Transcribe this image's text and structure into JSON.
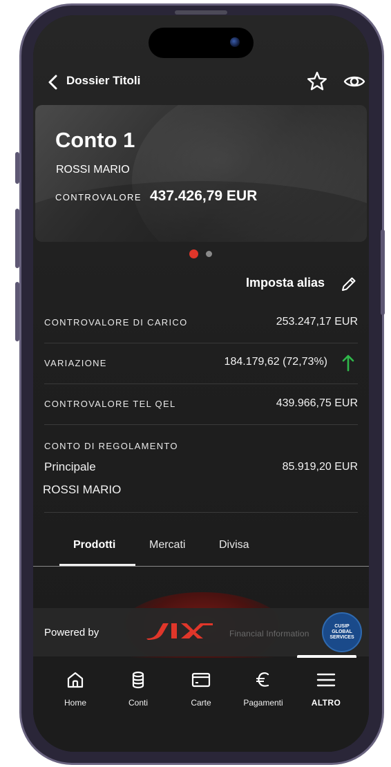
{
  "header": {
    "title": "Dossier Titoli"
  },
  "card": {
    "account_name": "Conto 1",
    "owner": "ROSSI MARIO",
    "controvalore_label": "CONTROVALORE",
    "controvalore_value": "437.426,79 EUR"
  },
  "pager": {
    "pages": 2,
    "active": 1
  },
  "alias": {
    "label": "Imposta alias"
  },
  "details": {
    "carico_label": "CONTROVALORE DI CARICO",
    "carico_value": "253.247,17 EUR",
    "variazione_label": "VARIAZIONE",
    "variazione_value": "184.179,62 (72,73%)",
    "variazione_trend": "up",
    "telqel_label": "CONTROVALORE TEL QEL",
    "telqel_value": "439.966,75 EUR",
    "regolamento_label": "CONTO DI REGOLAMENTO",
    "regolamento_name": "Principale",
    "regolamento_value": "85.919,20 EUR",
    "regolamento_owner": "ROSSI MARIO"
  },
  "tabs": [
    {
      "label": "Prodotti",
      "active": true
    },
    {
      "label": "Mercati",
      "active": false
    },
    {
      "label": "Divisa",
      "active": false
    }
  ],
  "banner": {
    "powered_by": "Powered by",
    "provider_info": "Financial Information",
    "cusip_line1": "CUSIP",
    "cusip_line2": "GLOBAL",
    "cusip_line3": "SERVICES"
  },
  "nav": [
    {
      "label": "Home",
      "icon": "home-icon"
    },
    {
      "label": "Conti",
      "icon": "database-icon"
    },
    {
      "label": "Carte",
      "icon": "card-icon"
    },
    {
      "label": "Pagamenti",
      "icon": "euro-icon"
    },
    {
      "label": "ALTRO",
      "icon": "menu-icon",
      "active": true
    }
  ],
  "colors": {
    "accent_red": "#e0362a",
    "trend_green": "#2fb84a",
    "background": "#1e1e1e"
  }
}
